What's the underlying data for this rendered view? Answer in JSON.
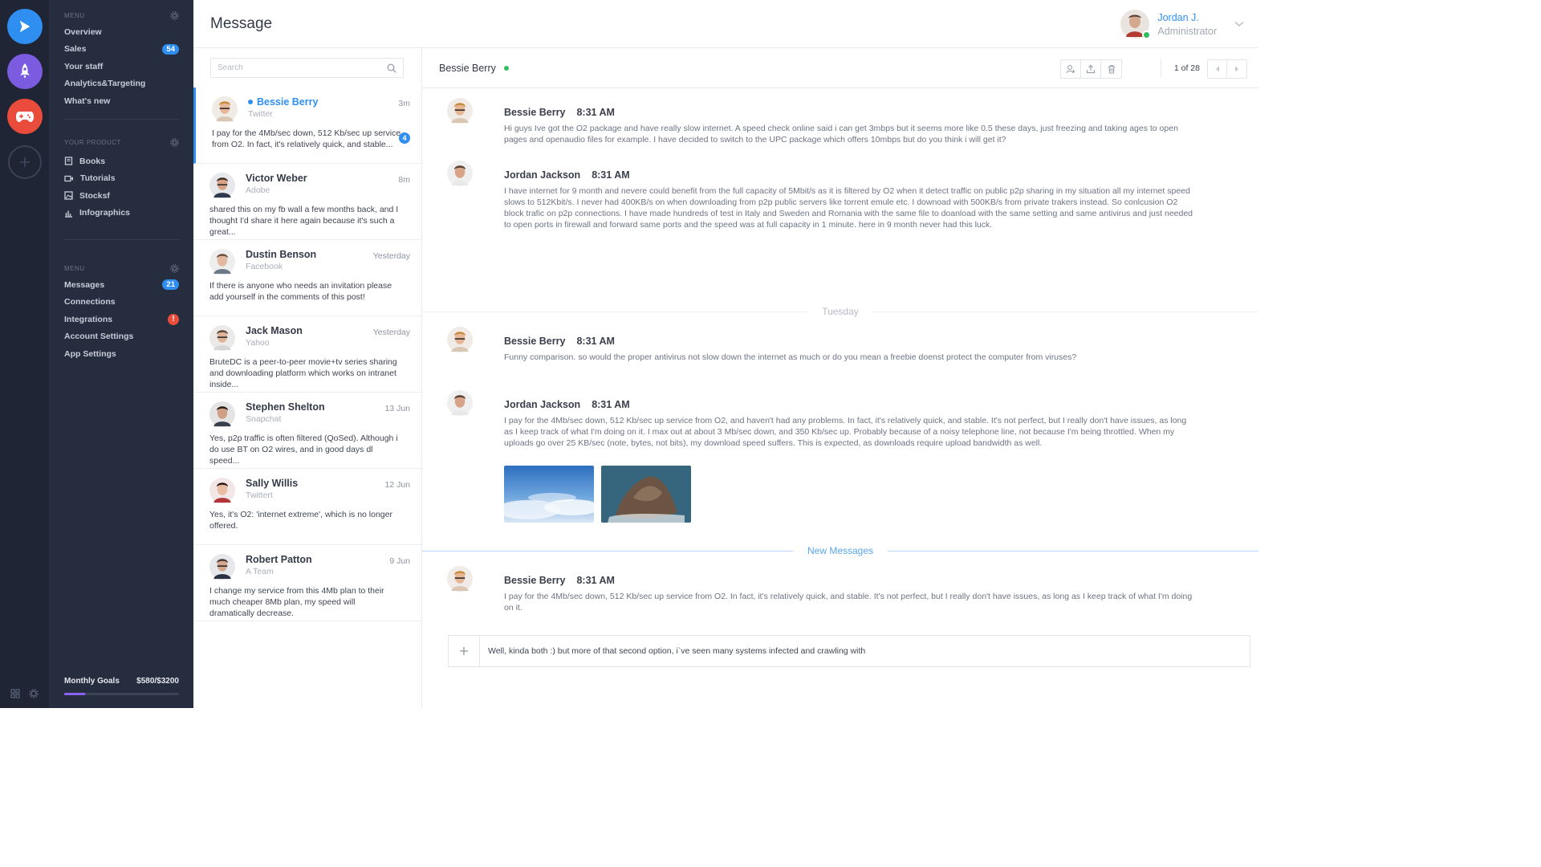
{
  "apps": [
    {
      "name": "send",
      "color": "#2f8ff0"
    },
    {
      "name": "rocket",
      "color": "#7b5be0"
    },
    {
      "name": "gamepad",
      "color": "#ea4c3c"
    }
  ],
  "menu1": {
    "title": "MENU",
    "items": [
      {
        "label": "Overview"
      },
      {
        "label": "Sales",
        "badge": "54"
      },
      {
        "label": "Your staff"
      },
      {
        "label": "Analytics&Targeting"
      },
      {
        "label": "What's new"
      }
    ]
  },
  "product": {
    "title": "YOUR PRODUCT",
    "items": [
      {
        "label": "Books",
        "icon": "book-icon"
      },
      {
        "label": "Tutorials",
        "icon": "video-icon"
      },
      {
        "label": "Stocksf",
        "icon": "image-icon"
      },
      {
        "label": "Infographics",
        "icon": "bar-chart-icon"
      }
    ]
  },
  "menu2": {
    "title": "MENU",
    "items": [
      {
        "label": "Messages",
        "badge": "21"
      },
      {
        "label": "Connections"
      },
      {
        "label": "Integrations",
        "alert": "!"
      },
      {
        "label": "Account Settings"
      },
      {
        "label": "App Settings"
      }
    ]
  },
  "goals": {
    "label": "Monthly Goals",
    "value": "$580/$3200",
    "progress": 0.18
  },
  "header": {
    "title": "Message"
  },
  "user": {
    "name": "Jordan J.",
    "role": "Administrator"
  },
  "search": {
    "placeholder": "Search"
  },
  "conversations": [
    {
      "name": "Bessie Berry",
      "source": "Twitter",
      "time": "3m",
      "text": "I pay for the 4Mb/sec down, 512 Kb/sec up service from O2. In fact, it's relatively quick, and stable...",
      "unread": "4"
    },
    {
      "name": "Victor Weber",
      "source": "Adobe",
      "time": "8m",
      "text": "shared this on my fb wall a few months back, and I thought I'd share it here again because it's such a great..."
    },
    {
      "name": "Dustin Benson",
      "source": "Facebook",
      "time": "Yesterday",
      "text": "If there is anyone who needs an invitation please add yourself in the comments of this post!"
    },
    {
      "name": "Jack Mason",
      "source": "Yahoo",
      "time": "Yesterday",
      "text": "BruteDC is a peer-to-peer movie+tv series sharing and downloading platform which works on intranet inside..."
    },
    {
      "name": "Stephen Shelton",
      "source": "Snapchat",
      "time": "13 Jun",
      "text": "Yes, p2p traffic is often filtered (QoSed). Although i do use BT on O2 wires, and in good days dl speed..."
    },
    {
      "name": "Sally Willis",
      "source": "Twittert",
      "time": "12 Jun",
      "text": "Yes, it's O2: 'internet extreme', which is no longer offered."
    },
    {
      "name": "Robert Patton",
      "source": "A Team",
      "time": "9 Jun",
      "text": "I change my service from this 4Mb plan to their much cheaper 8Mb plan, my speed will dramatically decrease."
    }
  ],
  "chat": {
    "contact": "Bessie Berry",
    "pager": "1 of 28",
    "messages": [
      {
        "author": "Bessie Berry",
        "time": "8:31 AM",
        "text": "Hi guys Ive got the O2 package and have really slow internet. A speed check online said i can get 3mbps but it seems more like 0.5 these days, just freezing and taking ages to open pages and openaudio files for example. I have decided to switch to the UPC package which offers 10mbps but do you think i will get it?"
      },
      {
        "author": "Jordan Jackson",
        "time": "8:31 AM",
        "text": "I have internet for 9 month and nevere could benefit from the full capacity of 5Mbit/s as it is filtered by O2 when it detect traffic on public p2p sharing in my situation all my internet speed slows to 512Kbit/s. I never had 400KB/s on when downloading from p2p public servers like torrent emule etc. I downoad with 500KB/s from private trakers instead. So conlcusion O2 block trafic on p2p connections. I have made hundreds of test in Italy and Sweden and Romania with the same file to doanload with the same setting and same antivirus and just needed to open ports in firewall and forward same ports and the speed was at full capacity in 1 minute. here in 9 month never had this luck."
      },
      {
        "author": "Bessie Berry",
        "time": "8:31 AM",
        "text": "Funny comparison. so would the proper antivirus not slow down the internet as much or do you mean a freebie doenst protect the computer from viruses?"
      },
      {
        "author": "Jordan Jackson",
        "time": "8:31 AM",
        "text": "I pay for the 4Mb/sec down, 512 Kb/sec up service from O2, and haven't had any problems. In fact, it's relatively quick, and stable. It's not perfect, but I really don't have issues, as long as I keep track of what I'm doing on it. I max out at about 3 Mb/sec down, and 350 Kb/sec up. Probably because of a noisy telephone line, not because I'm being throttled. When my uploads go over 25 KB/sec (note, bytes, not bits), my download speed suffers. This is expected, as downloads require upload bandwidth as well."
      },
      {
        "author": "Bessie Berry",
        "time": "8:31 AM",
        "text": "I pay for the 4Mb/sec down, 512 Kb/sec up service from O2. In fact, it's relatively quick, and stable. It's not perfect, but I really don't have issues, as long as I keep track of what I'm doing on it."
      }
    ],
    "divider_day": "Tuesday",
    "divider_new": "New Messages",
    "composer_value": "Well, kinda both :) but more of that second option, i`ve seen many systems infected and crawling with"
  },
  "colors": {
    "accent": "#2f8ff0",
    "online": "#2fbf5d",
    "alert": "#ea4c3c",
    "progress": "#8a64f0"
  }
}
